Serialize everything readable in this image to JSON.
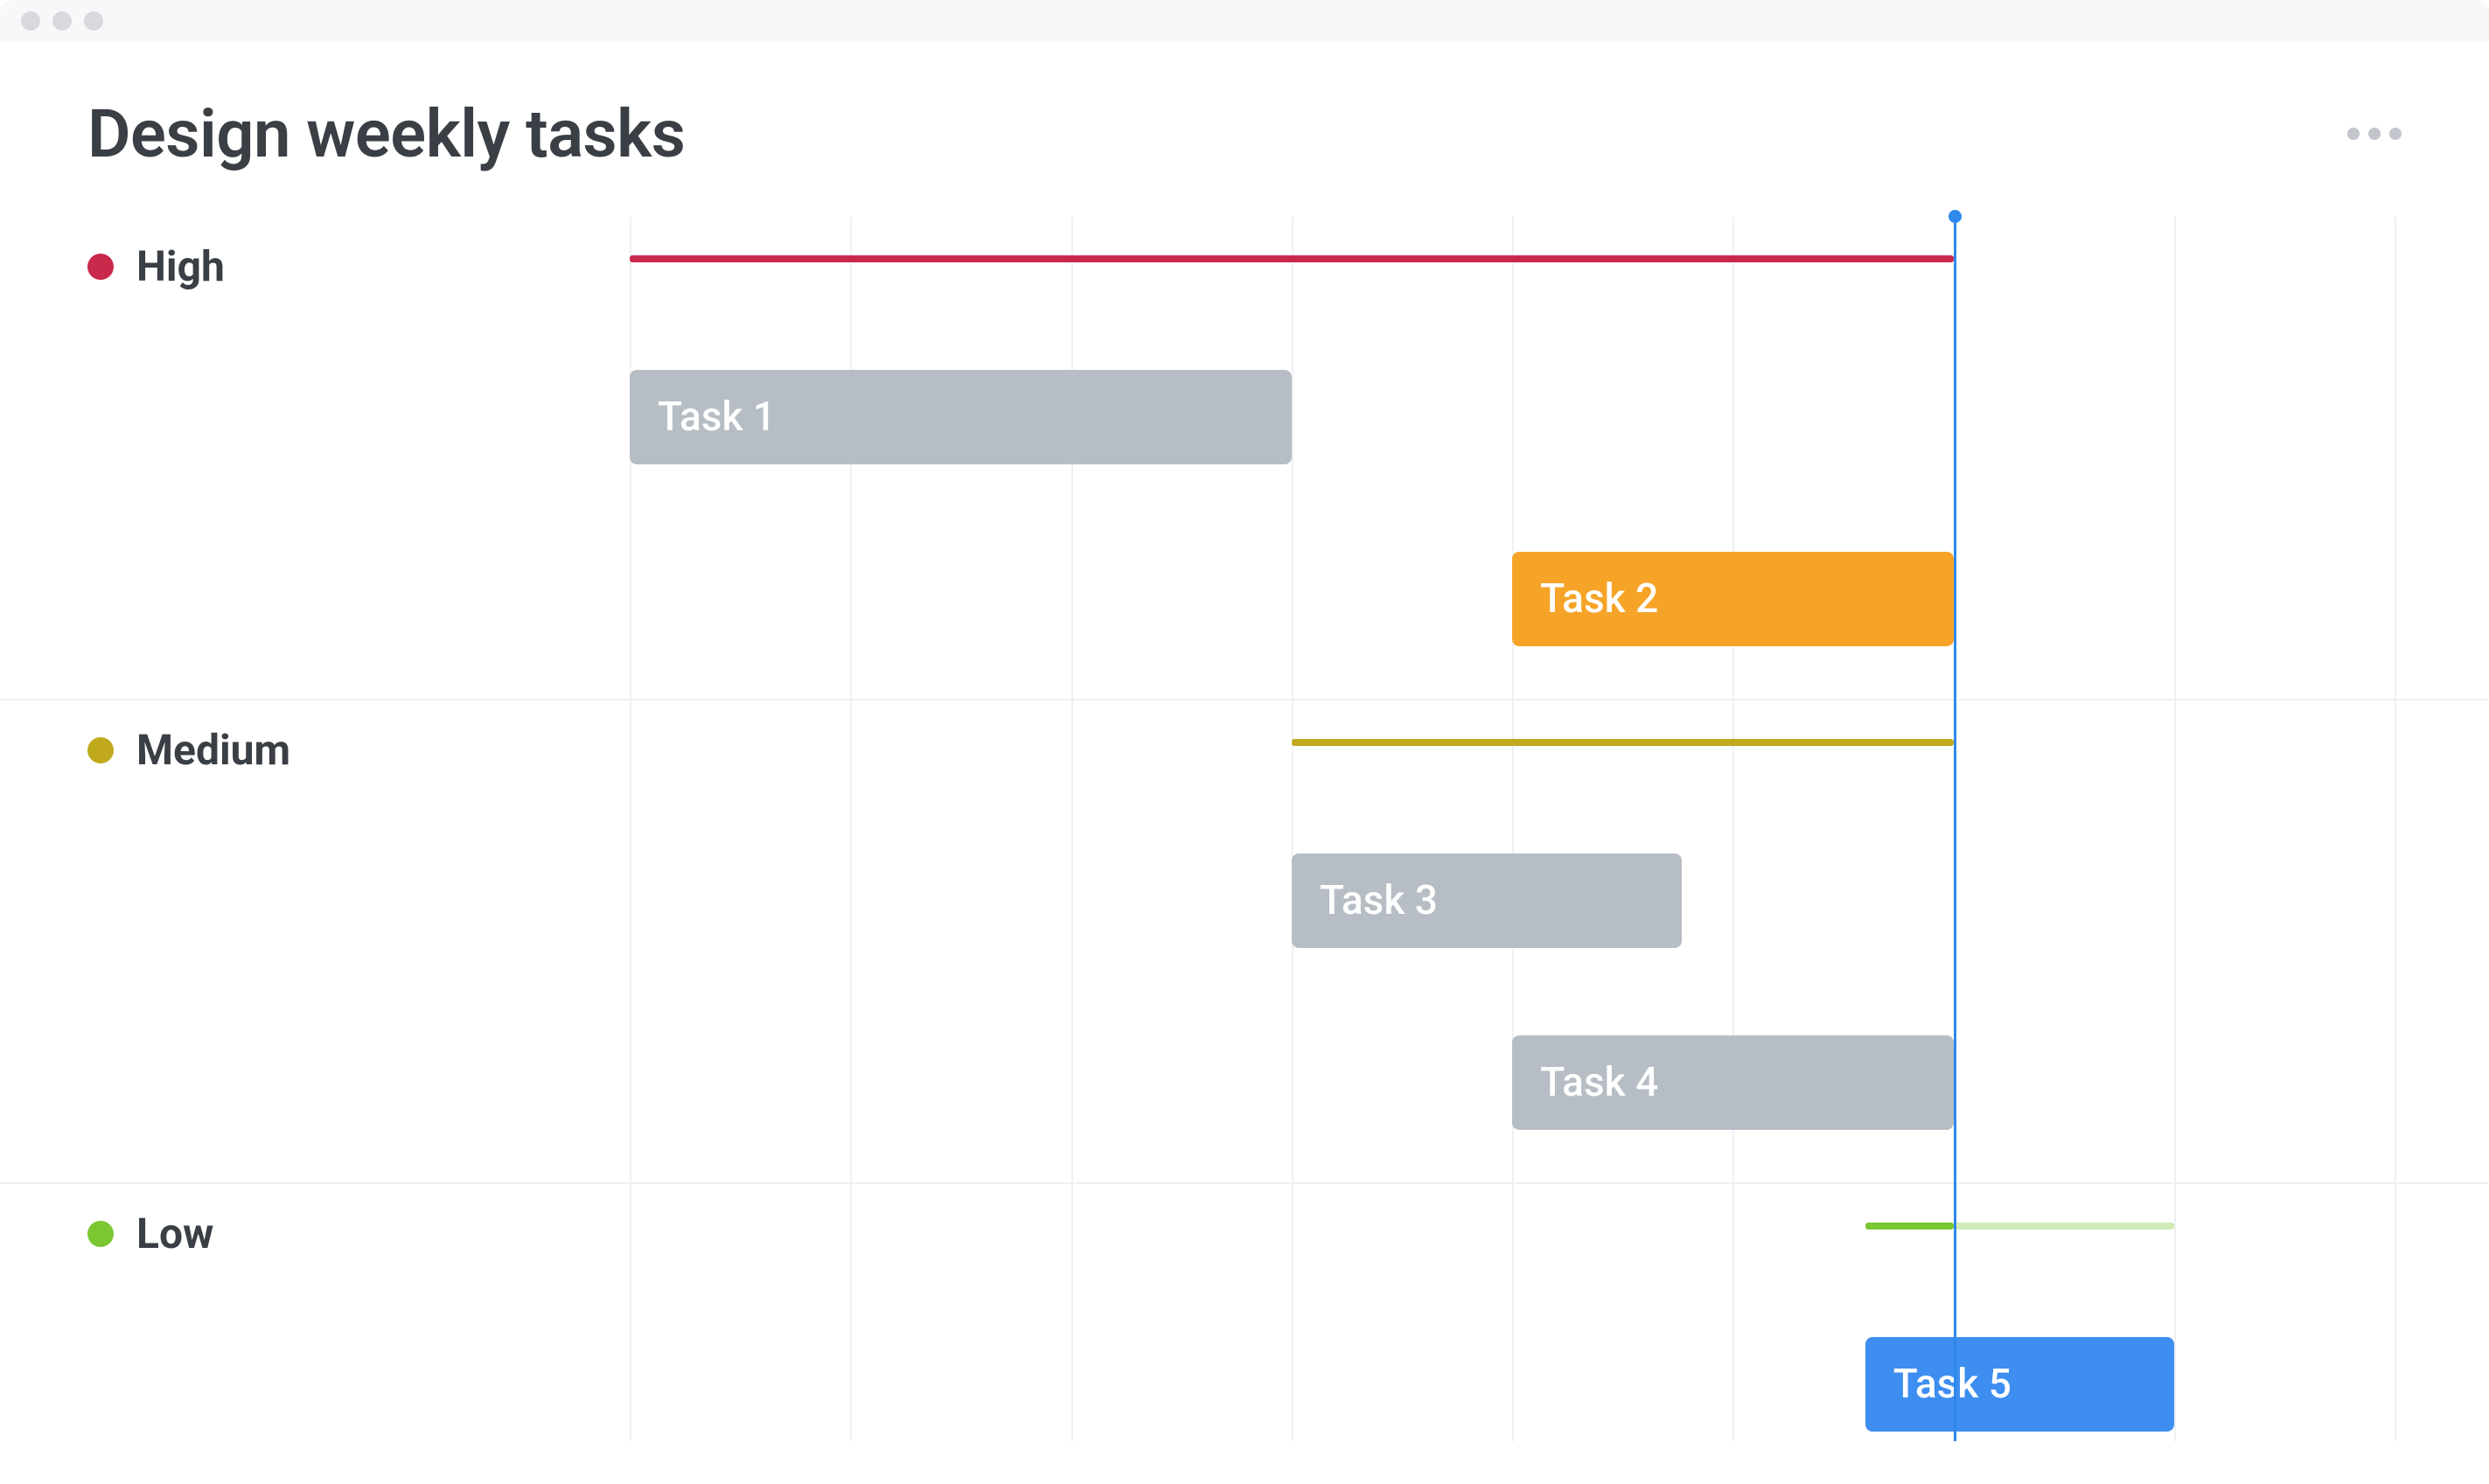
{
  "page": {
    "title": "Design weekly tasks"
  },
  "chart_data": {
    "type": "gantt",
    "columns": 7,
    "today_col": 6,
    "groups": [
      {
        "name": "High",
        "color": "#c9294b",
        "span": {
          "start": 0,
          "end": 6
        },
        "tasks": [
          {
            "label": "Task 1",
            "start": 0,
            "end": 3,
            "color": "gray"
          },
          {
            "label": "Task 2",
            "start": 4,
            "end": 6,
            "color": "orange"
          }
        ]
      },
      {
        "name": "Medium",
        "color": "#c0a91d",
        "span": {
          "start": 3,
          "end": 6
        },
        "tasks": [
          {
            "label": "Task 3",
            "start": 3,
            "end": 4.77,
            "color": "gray"
          },
          {
            "label": "Task 4",
            "start": 4,
            "end": 6,
            "color": "gray"
          }
        ]
      },
      {
        "name": "Low",
        "color": "#7ac732",
        "span": {
          "start": 5.6,
          "end": 7
        },
        "span_complete_end": 6,
        "tasks": [
          {
            "label": "Task 5",
            "start": 5.6,
            "end": 7,
            "color": "blue"
          }
        ]
      }
    ]
  },
  "colors": {
    "high": "#c9294b",
    "medium": "#c0a91d",
    "low": "#7ac732",
    "orange": "#f6a428",
    "blue": "#3d8ef0",
    "gray": "#b7bdc4",
    "today": "#2f88ec"
  }
}
